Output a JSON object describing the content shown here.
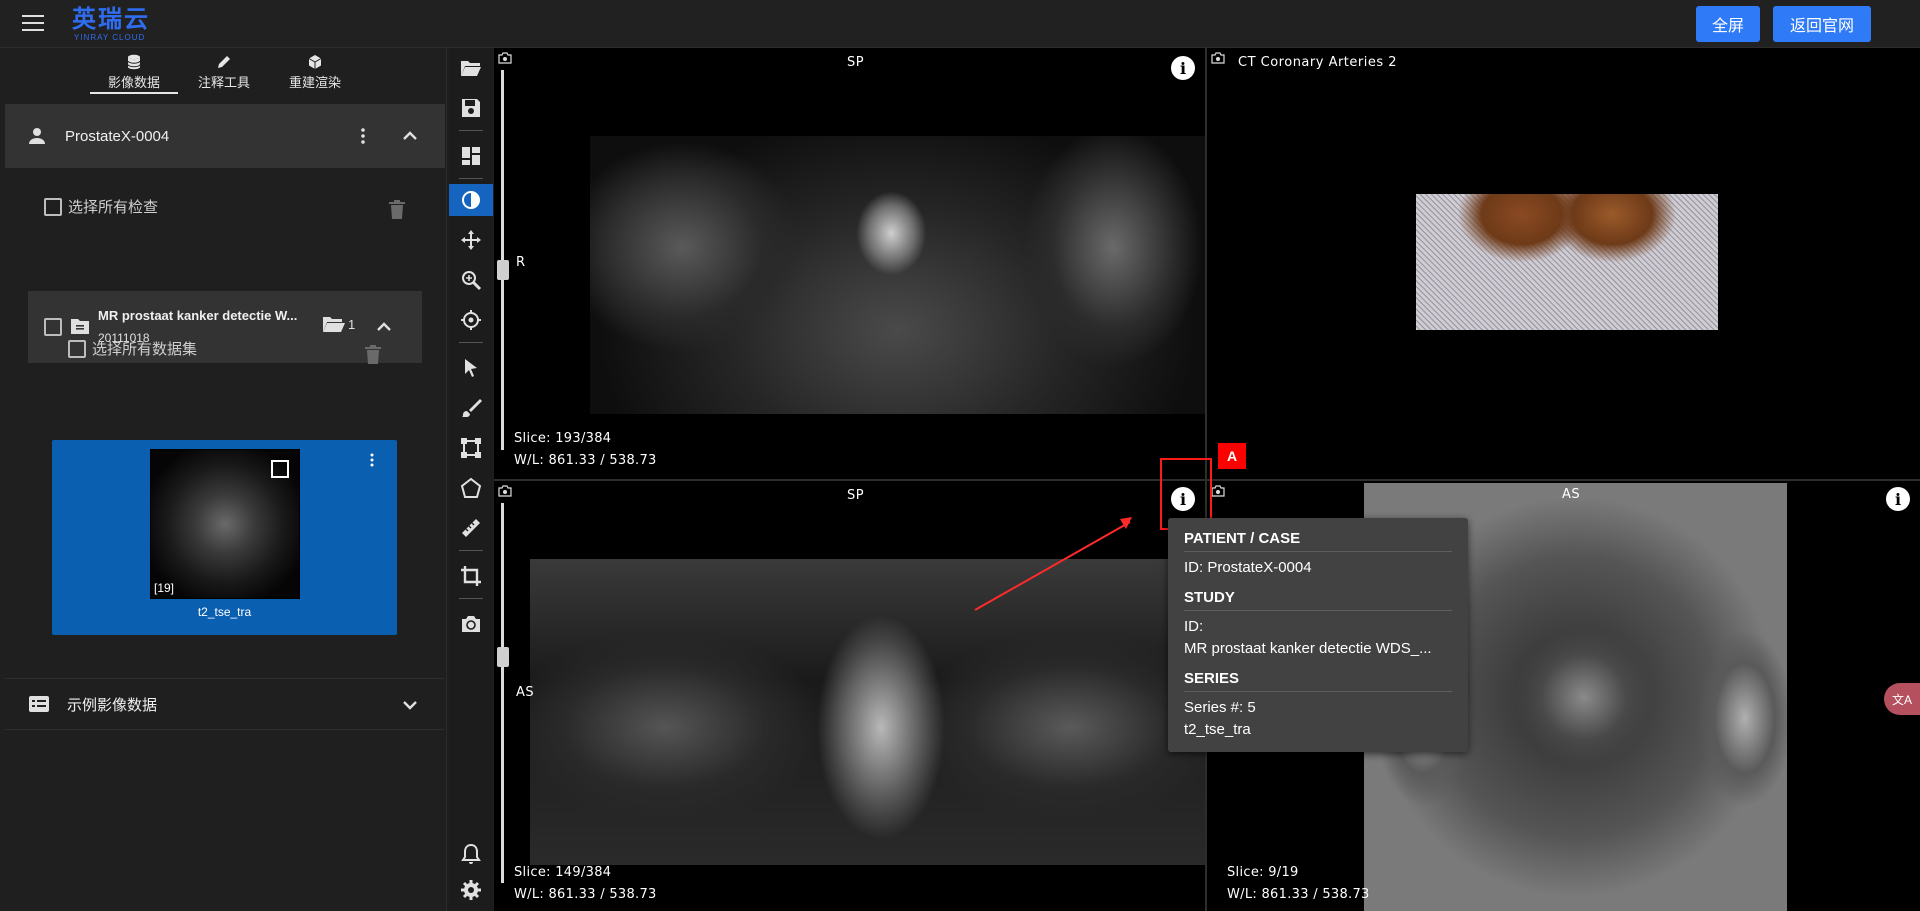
{
  "app": {
    "logo_main": "英瑞云",
    "logo_sub": "YINRAY CLOUD",
    "fullscreen_label": "全屏",
    "home_label": "返回官网"
  },
  "left_panel": {
    "tabs": [
      {
        "label": "影像数据",
        "icon": "database-icon",
        "active": true
      },
      {
        "label": "注释工具",
        "icon": "pencil-icon",
        "active": false
      },
      {
        "label": "重建渲染",
        "icon": "cube-icon",
        "active": false
      }
    ],
    "patient": {
      "name": "ProstateX-0004"
    },
    "select_all_studies": "选择所有检查",
    "study": {
      "title": "MR prostaat kanker detectie W...",
      "date": "20111018",
      "series_count": "1"
    },
    "select_all_series": "选择所有数据集",
    "series_card": {
      "name": "t2_tse_tra",
      "count": "[19]"
    },
    "example_data": "示例影像数据"
  },
  "viewports": {
    "top_left": {
      "orientation_top": "SP",
      "orientation_left": "R",
      "slice": "Slice: 193/384",
      "wl": "W/L: 861.33 / 538.73"
    },
    "top_right": {
      "title": "CT Coronary Arteries 2"
    },
    "bottom_left": {
      "orientation_top": "SP",
      "orientation_left": "AS",
      "slice": "Slice: 149/384",
      "wl": "W/L: 861.33 / 538.73"
    },
    "bottom_right": {
      "orientation_top": "AS",
      "slice": "Slice: 9/19",
      "wl": "W/L: 861.33 / 538.73"
    }
  },
  "annotation": {
    "tag": "A",
    "color": "#ff0000"
  },
  "info_popup": {
    "patient_heading": "PATIENT / CASE",
    "patient_id": "ID: ProstateX-0004",
    "study_heading": "STUDY",
    "study_id": "ID:",
    "study_desc": "MR prostaat kanker detectie WDS_...",
    "series_heading": "SERIES",
    "series_number": "Series #: 5",
    "series_desc": "t2_tse_tra"
  },
  "translate_fab": {
    "label": "文A"
  },
  "colors": {
    "accent": "#2f7af6",
    "active_tool": "#1565c0",
    "series_card": "#0a5fb0"
  }
}
